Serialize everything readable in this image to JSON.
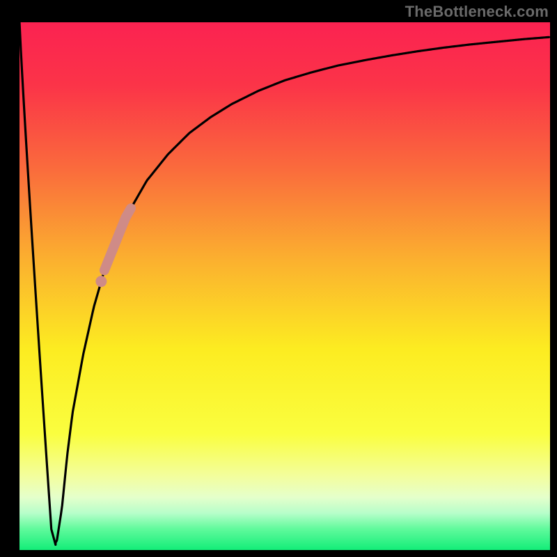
{
  "attribution": "TheBottleneck.com",
  "colors": {
    "frame": "#000000",
    "curve": "#000000",
    "highlight": "#cf8b87",
    "gradient_stops": [
      {
        "offset": 0.0,
        "color": "#fb2251"
      },
      {
        "offset": 0.12,
        "color": "#fb3448"
      },
      {
        "offset": 0.28,
        "color": "#fa6c3c"
      },
      {
        "offset": 0.45,
        "color": "#fbb02f"
      },
      {
        "offset": 0.62,
        "color": "#fcec21"
      },
      {
        "offset": 0.78,
        "color": "#fafe3f"
      },
      {
        "offset": 0.86,
        "color": "#f3fe9d"
      },
      {
        "offset": 0.9,
        "color": "#e5ffcb"
      },
      {
        "offset": 0.93,
        "color": "#b7feca"
      },
      {
        "offset": 0.96,
        "color": "#60fa9c"
      },
      {
        "offset": 1.0,
        "color": "#13ed78"
      }
    ]
  },
  "chart_data": {
    "type": "line",
    "title": "",
    "xlabel": "",
    "ylabel": "",
    "xlim": [
      0,
      100
    ],
    "ylim": [
      0,
      100
    ],
    "x": [
      0,
      1,
      2,
      3,
      4,
      5,
      6,
      7,
      8,
      9,
      10,
      12,
      14,
      16,
      18,
      20,
      24,
      28,
      32,
      36,
      40,
      45,
      50,
      55,
      60,
      65,
      70,
      75,
      80,
      85,
      90,
      95,
      100
    ],
    "values": [
      100,
      80,
      60,
      40,
      20,
      3,
      1,
      1.5,
      8,
      18,
      26,
      37,
      46,
      53,
      58,
      63,
      70,
      75,
      79,
      82,
      84.5,
      87,
      89,
      90.5,
      91.8,
      92.8,
      93.7,
      94.5,
      95.2,
      95.8,
      96.3,
      96.8,
      97.2
    ],
    "minimum_at_x": 6.2,
    "highlight_segment": {
      "x_start": 16,
      "x_end": 21
    }
  }
}
